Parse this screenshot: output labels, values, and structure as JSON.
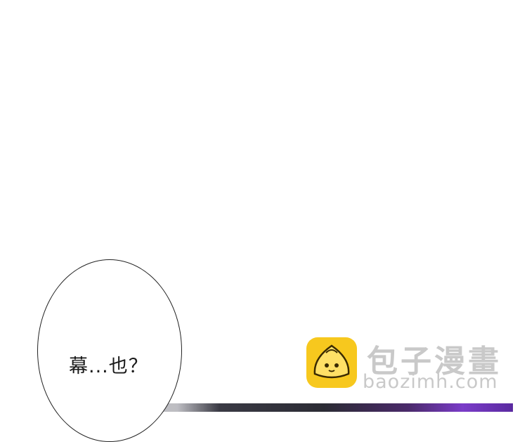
{
  "speech_bubble": {
    "text": "幕...也？"
  },
  "watermark": {
    "title": "包子漫畫",
    "url": "baozimh.com",
    "logo_icon": "bun-mascot-icon",
    "logo_color": "#f7c81e"
  }
}
